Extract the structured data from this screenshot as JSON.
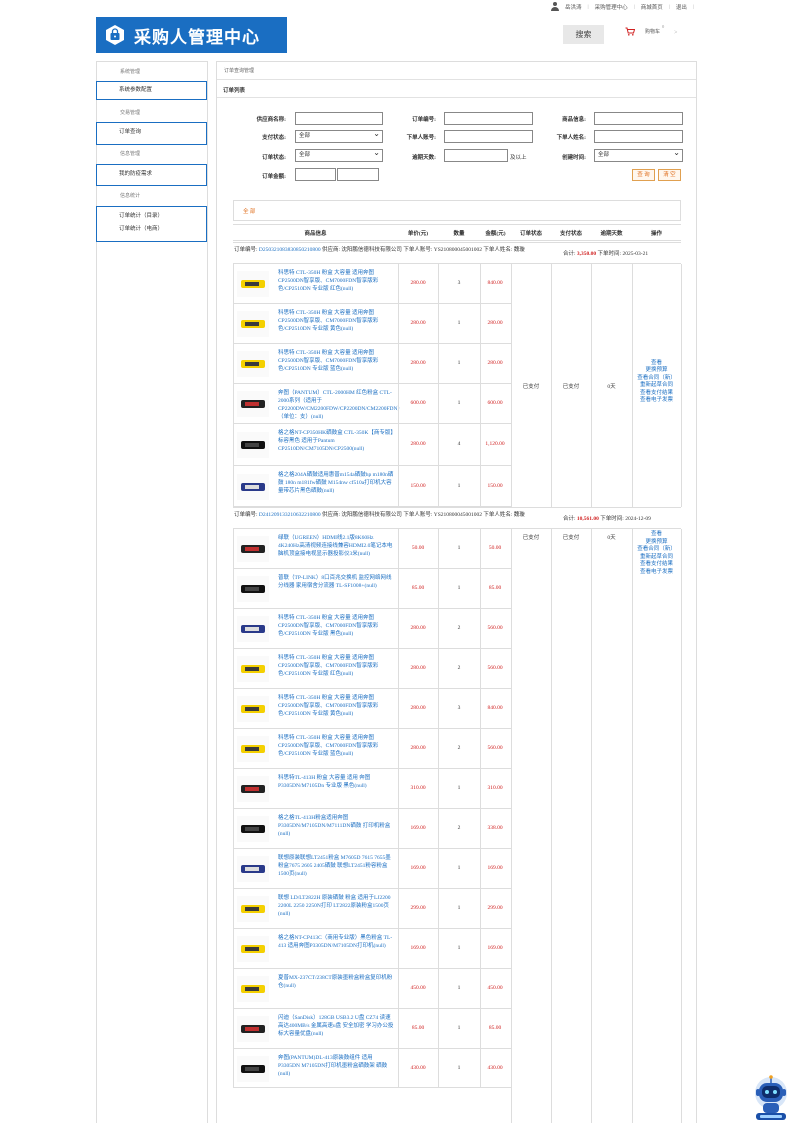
{
  "topbar": {
    "user": "岳洪涛",
    "links": [
      "采购管理中心",
      "商城首页",
      "退出"
    ]
  },
  "logo": {
    "title": "采购人管理中心"
  },
  "header": {
    "search_label": "搜索",
    "cart_label": "购物车",
    "cart_count": "0",
    "cart_arrow": ">"
  },
  "sidebar": {
    "sections": [
      {
        "title": "系统管理",
        "items": [
          "系统参数配置"
        ]
      },
      {
        "title": "交易管理",
        "items": [
          "订单查询"
        ]
      },
      {
        "title": "信息管理",
        "items": [
          "我的防疫需求"
        ]
      },
      {
        "title": "信息统计",
        "items": [
          "订单统计（目录）",
          "订单统计（电商）"
        ]
      }
    ]
  },
  "breadcrumb": "订单查询管理",
  "panel_title": "订单列表",
  "filters": {
    "supplier_label": "供应商名称:",
    "order_no_label": "订单编号:",
    "goods_label": "商品信息:",
    "pay_status_label": "支付状态:",
    "pay_status_value": "全部",
    "buyer_account_label": "下单人账号:",
    "buyer_name_label": "下单人姓名:",
    "order_status_label": "订单状态:",
    "order_status_value": "全部",
    "overdue_label": "逾期天数:",
    "overdue_suffix": "及以上",
    "created_label": "创建时间:",
    "created_value": "全部",
    "amount_label": "订单金额:",
    "query_btn": "查 询",
    "reset_btn": "清 空"
  },
  "tab_all": "全 部",
  "table_headers": [
    "商品信息",
    "单价(元)",
    "数量",
    "金额(元)",
    "订单状态",
    "支付状态",
    "逾期天数",
    "操作"
  ],
  "orders": [
    {
      "order_label": "订单编号:",
      "order_no": "D250321083830850210800",
      "supplier_label": "供应商:",
      "supplier": "沈阳鹏信德科技有限公司",
      "account_label": "下单人账号:",
      "account": "YS210800045001002",
      "name_label": "下单人姓名:",
      "name": "魏璇",
      "total_label": "合计:",
      "total": "3,350.00",
      "time_label": "下单时间:",
      "time": "2025-03-21",
      "order_status": "已支付",
      "pay_status": "已支付",
      "overdue": "0天",
      "ops": [
        "查看",
        "更换预算",
        "查看合同（新）",
        "重新起草合同",
        "查看支付结果",
        "查看电子发票"
      ],
      "items": [
        {
          "name": "科思特 CTL-350H 粉盒 大容量 适用奔图 CP2500DN智享版、CM7000FDN智享版彩色/CP2510DN 专业版 红色(null)",
          "price": "280.00",
          "qty": "3",
          "amount": "840.00"
        },
        {
          "name": "科思特 CTL-350H 粉盒 大容量 适用奔图 CP2500DN智享版、CM7000FDN智享版彩色/CP2510DN 专业版 黄色(null)",
          "price": "280.00",
          "qty": "1",
          "amount": "280.00"
        },
        {
          "name": "科思特 CTL-350H 粉盒 大容量 适用奔图 CP2500DN智享版、CM7000FDN智享版彩色/CP2510DN 专业版 蓝色(null)",
          "price": "280.00",
          "qty": "1",
          "amount": "280.00"
        },
        {
          "name": "奔图（PANTUM）CTL-2000HM 红色粉盒 CTL-2000系列（适用于CP2200DW/CM2200FDW/CP2200DN/CM2200FDN）（单位：支）(null)",
          "price": "600.00",
          "qty": "1",
          "amount": "600.00"
        },
        {
          "name": "格之格NT-CP350HK硒鼓盒 CTL-350K【商专版】标容黑色 适用于Pantum CP2510DN/CM7105DN/CP2500(null)",
          "price": "280.00",
          "qty": "4",
          "amount": "1,120.00"
        },
        {
          "name": "格之格204A硒鼓适用惠普m154a硒鼓hp m180n硒鼓 180n m181fw硒鼓 M154nw cf510a打印机大容量带芯片黑色硒鼓(null)",
          "price": "150.00",
          "qty": "1",
          "amount": "150.00"
        }
      ]
    },
    {
      "order_label": "订单编号:",
      "order_no": "D241209133210632210800",
      "supplier_label": "供应商:",
      "supplier": "沈阳鹏信德科技有限公司",
      "account_label": "下单人账号:",
      "account": "YS210800045001002",
      "name_label": "下单人姓名:",
      "name": "魏璇",
      "total_label": "合计:",
      "total": "10,561.00",
      "time_label": "下单时间:",
      "time": "2024-12-09",
      "order_status": "已支付",
      "pay_status": "已支付",
      "overdue": "0天",
      "ops": [
        "查看",
        "更换预算",
        "查看合同（新）",
        "重新起草合同",
        "查看支付结果",
        "查看电子发票"
      ],
      "items": [
        {
          "name": "绿联（UGREEN）HDMI线2.1版8K60Hz 4K240Hz高清视频连接线兼容HDMI2.0笔记本电脑机顶盒接电视显示器投影仪3米(null)",
          "price": "50.00",
          "qty": "1",
          "amount": "50.00"
        },
        {
          "name": "普联（TP-LINK）8口百兆交换机 监控网络网线分线器 家用宿舍分流器 TL-SF1008+(null)",
          "price": "85.00",
          "qty": "1",
          "amount": "85.00"
        },
        {
          "name": "科思特 CTL-350H 粉盒 大容量 适用奔图 CP2500DN智享版、CM7000FDN智享版彩色/CP2510DN 专业版 黑色(null)",
          "price": "280.00",
          "qty": "2",
          "amount": "560.00"
        },
        {
          "name": "科思特 CTL-350H 粉盒 大容量 适用奔图 CP2500DN智享版、CM7000FDN智享版彩色/CP2510DN 专业版 红色(null)",
          "price": "280.00",
          "qty": "2",
          "amount": "560.00"
        },
        {
          "name": "科思特 CTL-350H 粉盒 大容量 适用奔图 CP2500DN智享版、CM7000FDN智享版彩色/CP2510DN 专业版 黄色(null)",
          "price": "280.00",
          "qty": "3",
          "amount": "840.00"
        },
        {
          "name": "科思特 CTL-350H 粉盒 大容量 适用奔图 CP2500DN智享版、CM7000FDN智享版彩色/CP2510DN 专业版 蓝色(null)",
          "price": "280.00",
          "qty": "2",
          "amount": "560.00"
        },
        {
          "name": "科思特TL-413H 粉盒 大容量 适用 奔图 P3305DN/M7105Dn 专业版 黑色(null)",
          "price": "310.00",
          "qty": "1",
          "amount": "310.00"
        },
        {
          "name": "格之格TL-413H粉盒适用奔图P3305DN/M7105DN/M7111DN硒鼓 打印机粉盒(null)",
          "price": "169.00",
          "qty": "2",
          "amount": "338.00"
        },
        {
          "name": "联想原装联想LT2451粉盒 M7605D 7615 7655墨粉盒7675 2605 2405硒鼓 联想LT2451粉容粉盒 1500页(null)",
          "price": "169.00",
          "qty": "1",
          "amount": "169.00"
        },
        {
          "name": "联想 LD/LT2822H 原装硒鼓 粉盒 适用于LJ2200 2200L 2250 2250N打印 LT2822原装粉盒1500页(null)",
          "price": "299.00",
          "qty": "1",
          "amount": "299.00"
        },
        {
          "name": "格之格NT-CP413C（商用专业版）黑色粉盒 TL-413 适用奔图P3305DN/M7105DN打印机(null)",
          "price": "169.00",
          "qty": "1",
          "amount": "169.00"
        },
        {
          "name": "夏普MX-237CT/238CT原装墨粉盒粉盒复印机粉仓(null)",
          "price": "450.00",
          "qty": "1",
          "amount": "450.00"
        },
        {
          "name": "闪迪（SanDisk）128GB USB3.2 U盘 CZ74 读速高达400MB/s 金属高速u盘 安全加密 学习办公投标大容量优盘(null)",
          "price": "85.00",
          "qty": "1",
          "amount": "85.00"
        },
        {
          "name": "奔图(PANTUM)DL-413原装鼓组件 适用P3305DN M7105DN打印机墨粉盒硒鼓架 硒鼓(null)",
          "price": "430.00",
          "qty": "1",
          "amount": "430.00"
        }
      ]
    }
  ],
  "colors": {
    "primary": "#1a6ec2",
    "accent": "#e07020",
    "price_red": "#d02020"
  }
}
